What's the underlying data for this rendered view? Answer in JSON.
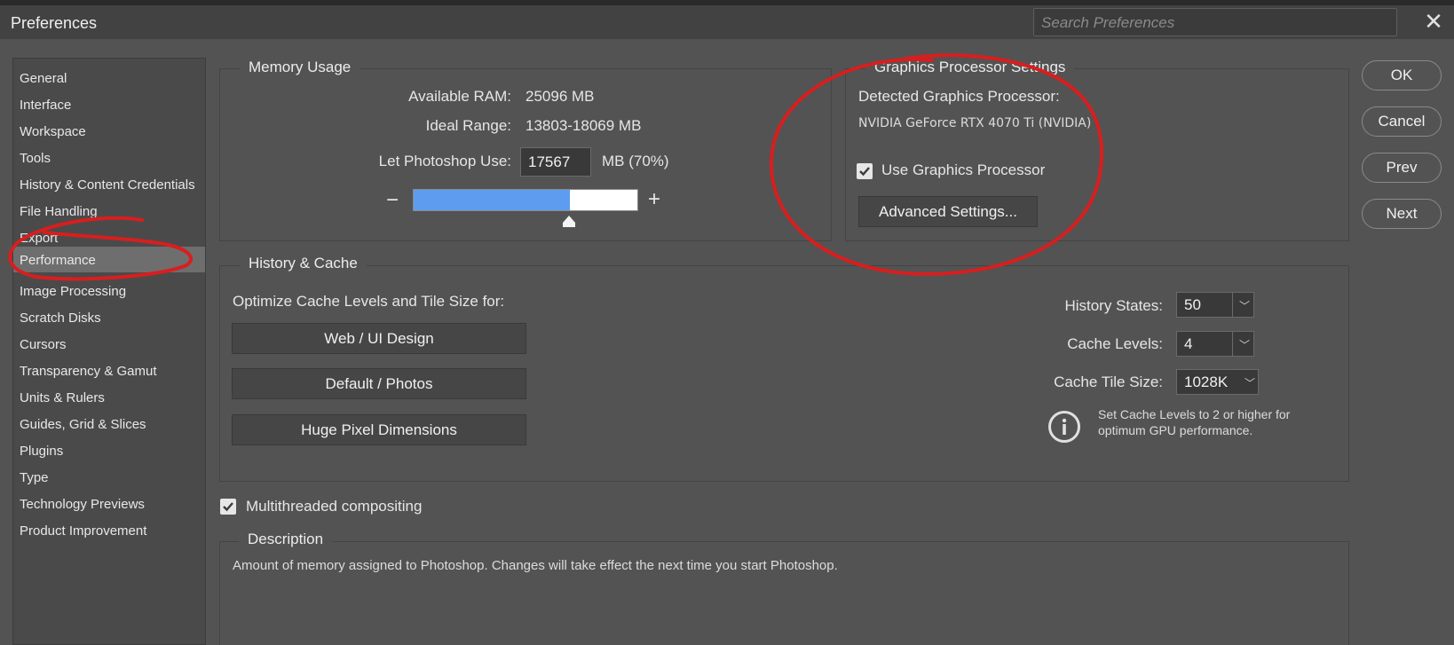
{
  "window": {
    "title": "Preferences",
    "search_placeholder": "Search Preferences",
    "close_glyph": "✕"
  },
  "sidebar": {
    "items": [
      "General",
      "Interface",
      "Workspace",
      "Tools",
      "History & Content Credentials",
      "File Handling",
      "Export",
      "Performance",
      "Image Processing",
      "Scratch Disks",
      "Cursors",
      "Transparency & Gamut",
      "Units & Rulers",
      "Guides, Grid & Slices",
      "Plugins",
      "Type",
      "Technology Previews",
      "Product Improvement"
    ],
    "active": "Performance"
  },
  "memory": {
    "legend": "Memory Usage",
    "available_label": "Available RAM:",
    "available_value": "25096 MB",
    "ideal_label": "Ideal Range:",
    "ideal_value": "13803-18069 MB",
    "use_label": "Let Photoshop Use:",
    "use_value": "17567",
    "use_suffix": "MB (70%)",
    "minus": "−",
    "plus": "+",
    "slider_fraction": 0.7
  },
  "gpu": {
    "legend": "Graphics Processor Settings",
    "detected_label": "Detected Graphics Processor:",
    "detected_value": "NVIDIA GeForce RTX 4070 Ti (NVIDIA)",
    "use_label": "Use Graphics Processor",
    "use_checked": true,
    "advanced_button": "Advanced Settings..."
  },
  "history_cache": {
    "legend": "History & Cache",
    "optimize_label": "Optimize Cache Levels and Tile Size for:",
    "buttons": [
      "Web / UI Design",
      "Default / Photos",
      "Huge Pixel Dimensions"
    ],
    "history_states_label": "History States:",
    "history_states_value": "50",
    "cache_levels_label": "Cache Levels:",
    "cache_levels_value": "4",
    "tile_size_label": "Cache Tile Size:",
    "tile_size_value": "1028K",
    "info_text": "Set Cache Levels to 2 or higher for optimum GPU performance."
  },
  "multithreaded": {
    "label": "Multithreaded compositing",
    "checked": true
  },
  "description": {
    "legend": "Description",
    "text": "Amount of memory assigned to Photoshop. Changes will take effect the next time you start Photoshop."
  },
  "actions": {
    "ok": "OK",
    "cancel": "Cancel",
    "prev": "Prev",
    "next": "Next"
  },
  "colors": {
    "accent": "#5d9cef",
    "annotation": "#d81e1e",
    "background": "#535353"
  }
}
